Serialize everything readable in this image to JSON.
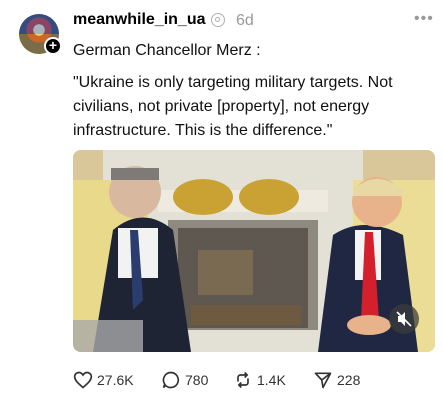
{
  "post": {
    "username": "meanwhile_in_ua",
    "time": "6d",
    "line1": "German Chancellor Merz :",
    "line2": "\"Ukraine is only targeting military targets. Not civilians, not private [property], not energy infrastructure. This is the difference.\""
  },
  "actions": {
    "likes": "27.6K",
    "comments": "780",
    "reposts": "1.4K",
    "shares": "228"
  },
  "icons": {
    "verified": "threads-verified-icon",
    "more": "more-icon",
    "like": "heart-icon",
    "comment": "comment-icon",
    "repost": "repost-icon",
    "share": "share-icon",
    "mute": "muted-speaker-icon"
  }
}
